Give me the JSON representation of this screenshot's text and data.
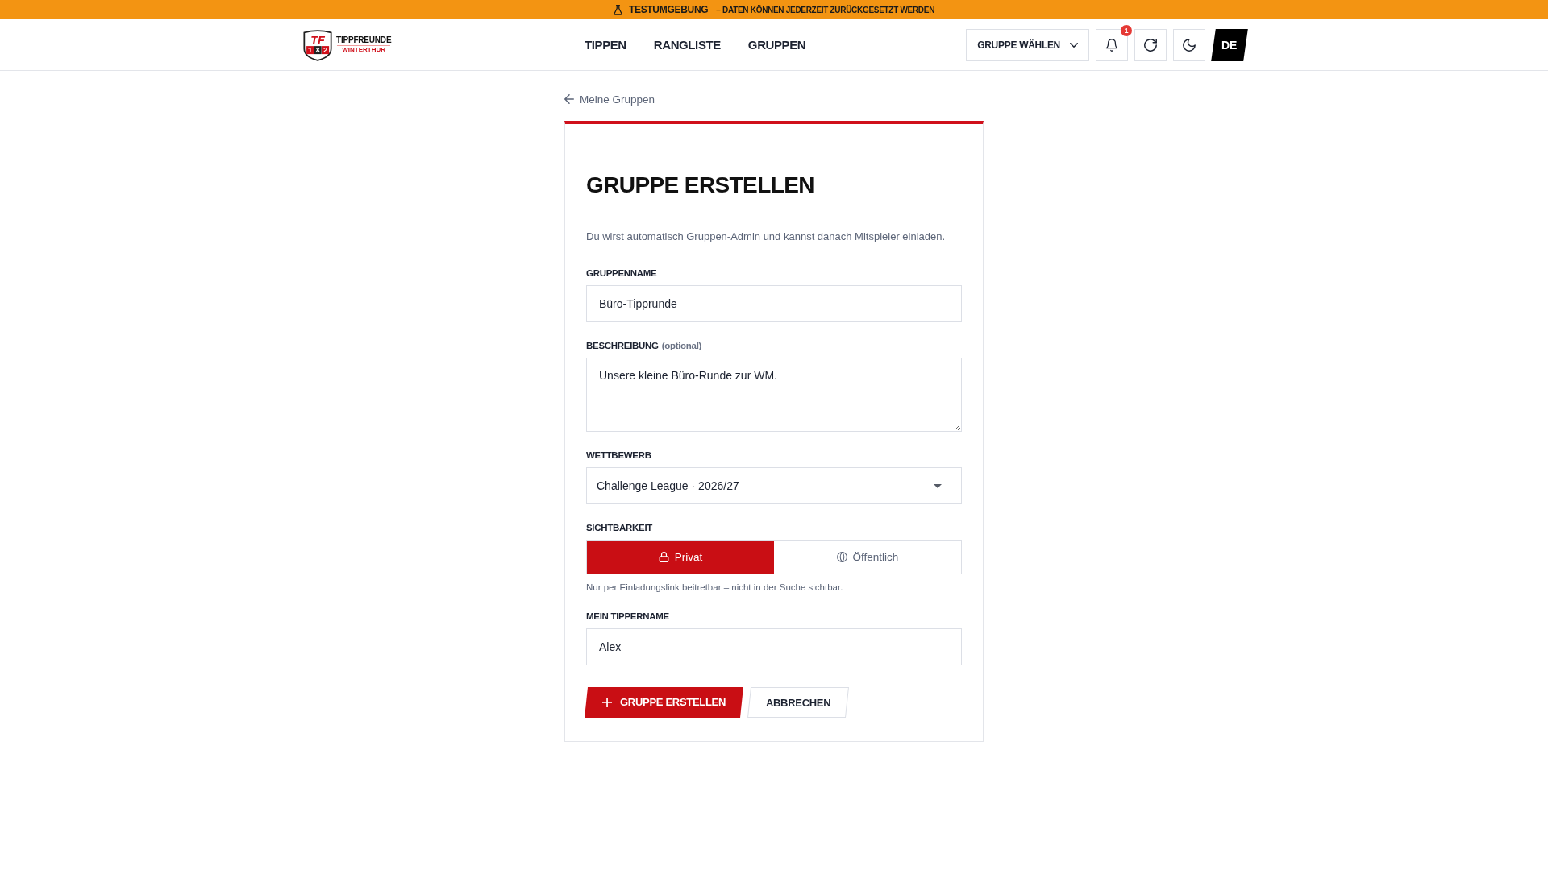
{
  "banner": {
    "title": "TESTUMGEBUNG",
    "message": "– DATEN KÖNNEN JEDERZEIT ZURÜCKGESETZT WERDEN"
  },
  "header": {
    "logo": {
      "emblem": "TF",
      "marks": [
        "1",
        "X",
        "2"
      ],
      "name": "TIPPFREUNDE",
      "subtitle": "WINTERTHUR"
    },
    "nav": [
      {
        "label": "TIPPEN",
        "selected": false
      },
      {
        "label": "RANGLISTE",
        "selected": false
      },
      {
        "label": "GRUPPEN",
        "selected": false
      }
    ],
    "group_select": {
      "label": "GRUPPE WÄHLEN"
    },
    "notifications": {
      "count": "1"
    },
    "language": "DE"
  },
  "back_link": "Meine Gruppen",
  "form": {
    "title": "GRUPPE ERSTELLEN",
    "intro": "Du wirst automatisch Gruppen-Admin und kannst danach Mitspieler einladen.",
    "fields": [
      {
        "kind": "text",
        "label": "GRUPPENNAME",
        "value": "Büro-Tipprunde"
      },
      {
        "kind": "textarea",
        "label": "BESCHREIBUNG",
        "note": "(optional)",
        "value": "Unsere kleine Büro-Runde zur WM."
      },
      {
        "kind": "select",
        "label": "WETTBEWERB",
        "value": "Challenge League · 2026/27"
      },
      {
        "kind": "segmented",
        "label": "SICHTBARKEIT",
        "options": [
          {
            "kind": "private",
            "label": "Privat",
            "selected": true
          },
          {
            "kind": "public",
            "label": "Öffentlich",
            "selected": false
          }
        ],
        "hint": "Nur per Einladungslink beitretbar – nicht in der Suche sichtbar."
      },
      {
        "kind": "text",
        "label": "MEIN TIPPERNAME",
        "value": "Alex"
      }
    ],
    "buttons": [
      {
        "kind": "primary",
        "label": "GRUPPE ERSTELLEN"
      },
      {
        "kind": "secondary",
        "label": "ABBRECHEN"
      }
    ]
  }
}
